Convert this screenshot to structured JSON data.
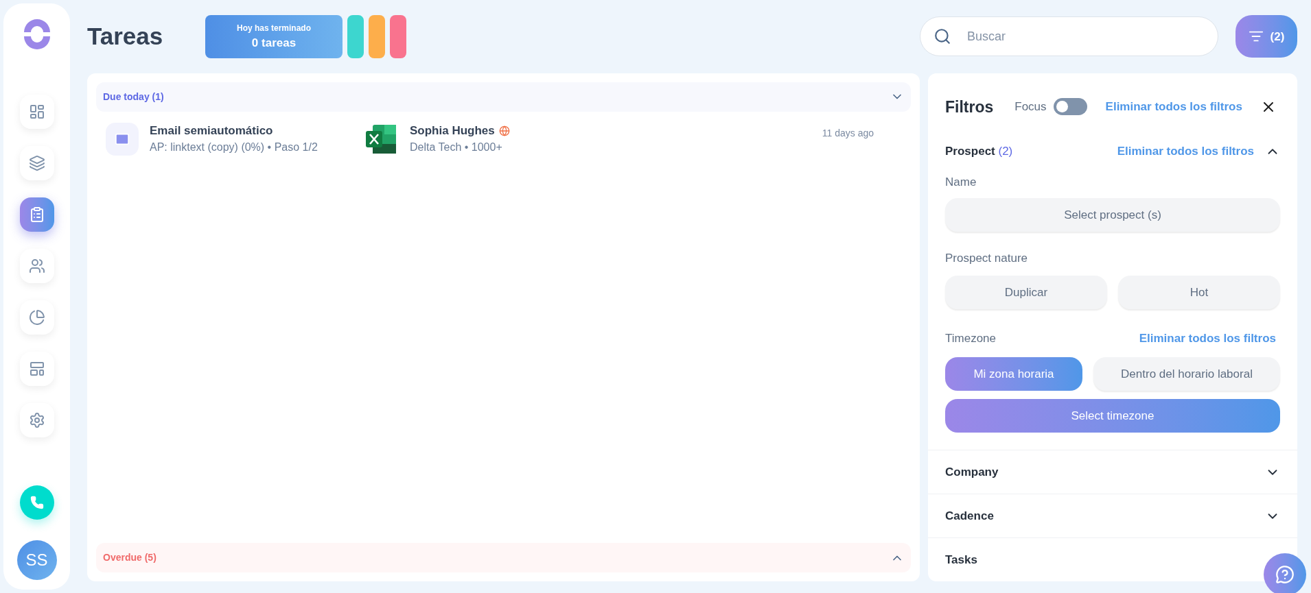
{
  "sidebar": {
    "items": [
      {
        "kind": "dashboard",
        "selected": false
      },
      {
        "kind": "stack",
        "selected": false
      },
      {
        "kind": "clipboard",
        "selected": true
      },
      {
        "kind": "people",
        "selected": false
      },
      {
        "kind": "pie",
        "selected": false
      },
      {
        "kind": "layout",
        "selected": false
      },
      {
        "kind": "settings",
        "selected": false
      }
    ],
    "avatar": "SS"
  },
  "header": {
    "title": "Tareas",
    "stats": {
      "label": "Hoy has terminado",
      "value": "0 tareas"
    },
    "pills": [
      {
        "color": "#3dd6cf"
      },
      {
        "color": "#fdae4b"
      },
      {
        "color": "#f9738e"
      }
    ],
    "search": {
      "placeholder": "Buscar"
    },
    "filter_button": {
      "count": "(2)"
    }
  },
  "task_groups": [
    {
      "kind": "due",
      "label": "Due today (1)",
      "expanded": true,
      "tasks": [
        {
          "title": "Email semiautomático",
          "subtitle": "AP: linktext (copy) (0%) • Paso 1/2",
          "prospect": "Sophia Hughes",
          "company": "Delta Tech • 1000+",
          "time": "11 days ago"
        }
      ]
    },
    {
      "kind": "overdue",
      "label": "Overdue (5)",
      "expanded": false
    }
  ],
  "filters": {
    "title": "Filtros",
    "focus": {
      "label": "Focus",
      "on": false
    },
    "clear_all": "Eliminar todos los filtros",
    "sections": [
      {
        "title": "Prospect",
        "count": "(2)",
        "clear": "Eliminar todos los filtros",
        "expanded": true,
        "groups": [
          {
            "kind": "select",
            "label": "Name",
            "button": "Select prospect (s)"
          },
          {
            "kind": "options",
            "label": "Prospect nature",
            "options": [
              {
                "label": "Duplicar",
                "selected": false
              },
              {
                "label": "Hot",
                "selected": false
              }
            ]
          },
          {
            "kind": "timezone",
            "label": "Timezone",
            "clear": "Eliminar todos los filtros",
            "options": [
              {
                "label": "Mi zona horaria",
                "selected": true
              },
              {
                "label": "Dentro del horario laboral",
                "selected": false
              }
            ],
            "button": "Select timezone"
          }
        ]
      },
      {
        "title": "Company",
        "expanded": false
      },
      {
        "title": "Cadence",
        "expanded": false
      },
      {
        "title": "Tasks"
      }
    ]
  }
}
